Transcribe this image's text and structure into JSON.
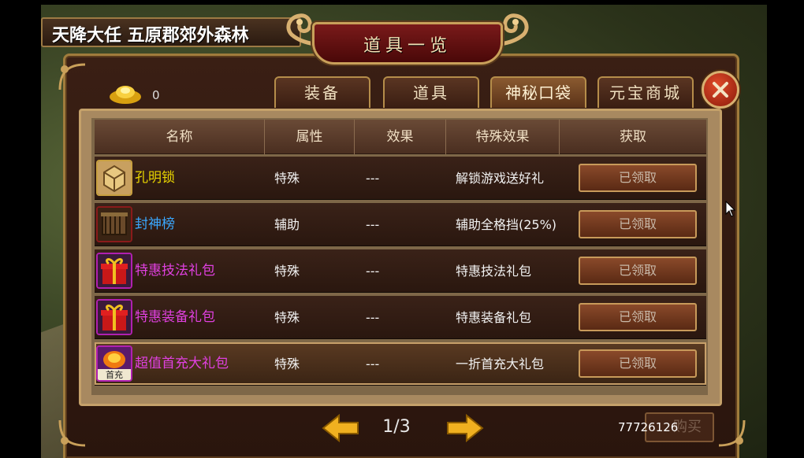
{
  "location": "天降大任 五原郡郊外森林",
  "window": {
    "title": "道具一览"
  },
  "currency": {
    "gold_ingot": "0"
  },
  "tabs": [
    {
      "label": "装备",
      "active": false
    },
    {
      "label": "道具",
      "active": false
    },
    {
      "label": "神秘口袋",
      "active": true
    },
    {
      "label": "元宝商城",
      "active": false
    }
  ],
  "table": {
    "headers": [
      "名称",
      "属性",
      "效果",
      "特殊效果",
      "获取"
    ],
    "rows": [
      {
        "icon": "kongming-lock-icon",
        "name": "孔明锁",
        "name_color": "#e8d400",
        "attribute": "特殊",
        "effect": "---",
        "special": "解锁游戏送好礼",
        "action": "已领取"
      },
      {
        "icon": "fengshen-scroll-icon",
        "name": "封神榜",
        "name_color": "#3aa8ff",
        "attribute": "辅助",
        "effect": "---",
        "special": "辅助全格挡(25%)",
        "action": "已领取"
      },
      {
        "icon": "gift-box-icon",
        "name": "特惠技法礼包",
        "name_color": "#e040e0",
        "attribute": "特殊",
        "effect": "---",
        "special": "特惠技法礼包",
        "action": "已领取"
      },
      {
        "icon": "gift-box-icon",
        "name": "特惠装备礼包",
        "name_color": "#e040e0",
        "attribute": "特殊",
        "effect": "---",
        "special": "特惠装备礼包",
        "action": "已领取"
      },
      {
        "icon": "first-charge-icon",
        "name": "超值首充大礼包",
        "name_color": "#e040e0",
        "attribute": "特殊",
        "effect": "---",
        "special": "一折首充大礼包",
        "action": "已领取",
        "icon_text": "首充"
      }
    ]
  },
  "pagination": {
    "page": "1/3"
  },
  "footer": {
    "account_id": "77726126",
    "buy_label": "购买"
  }
}
